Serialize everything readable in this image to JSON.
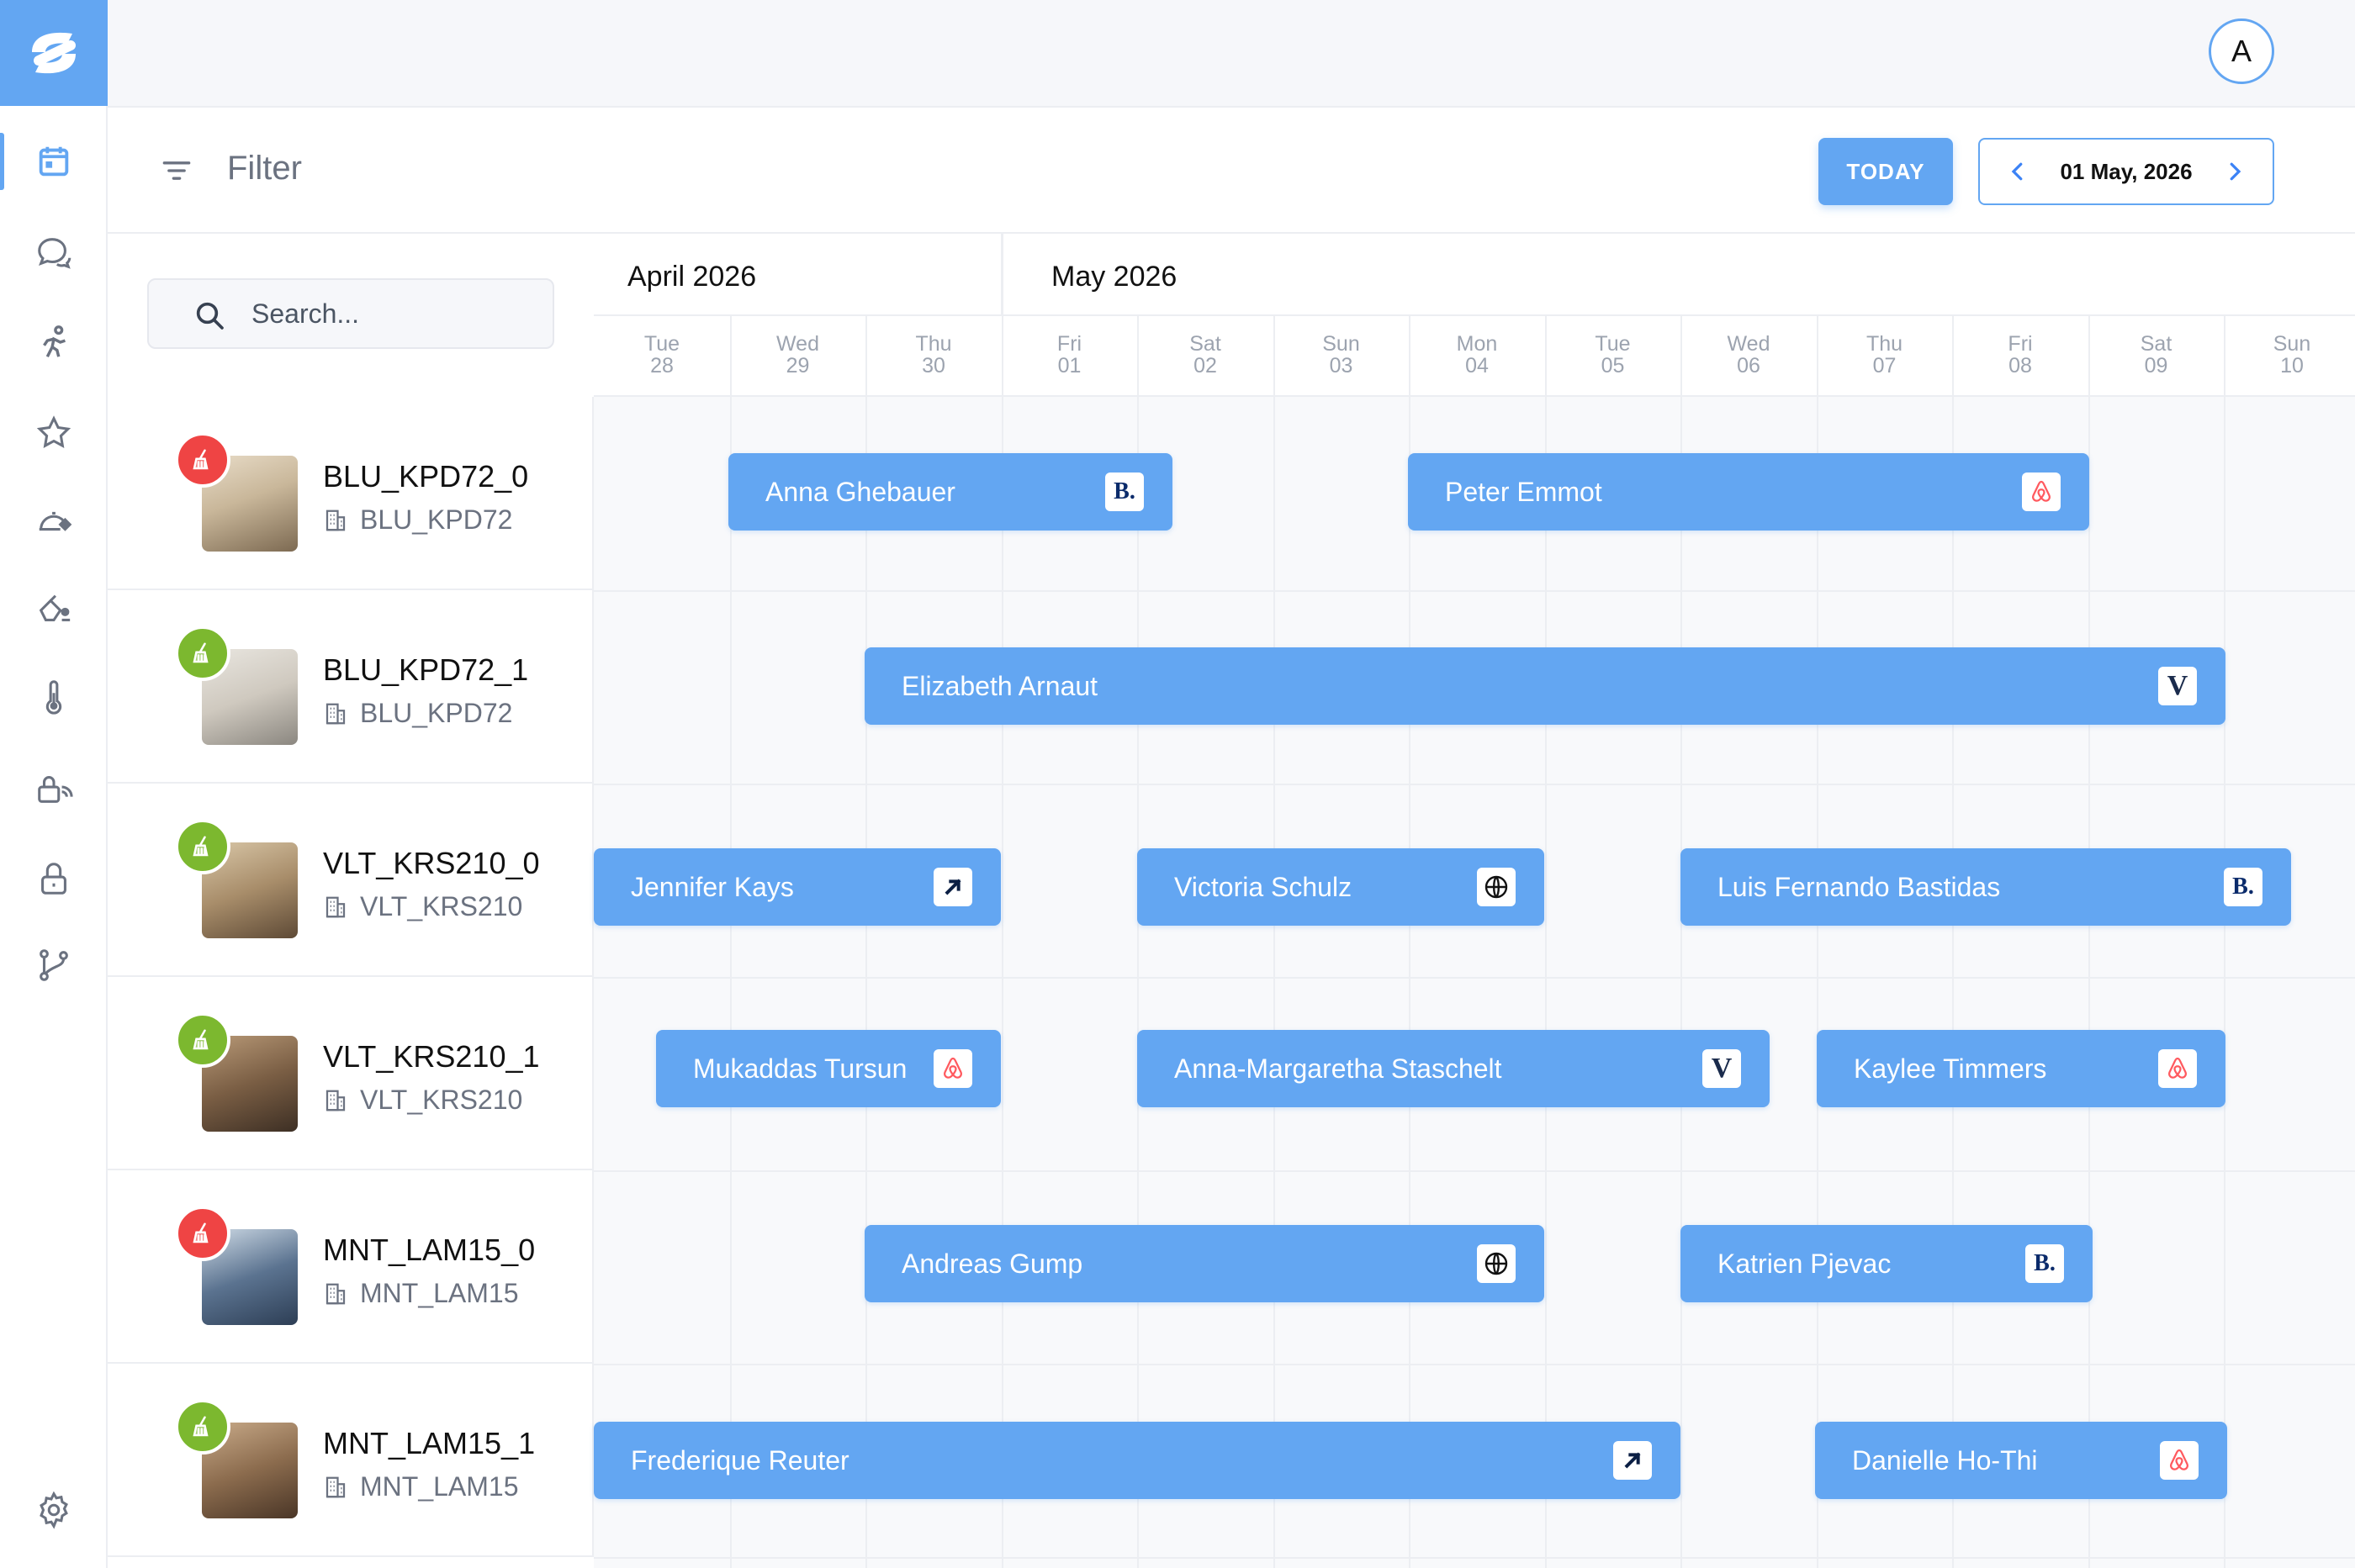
{
  "app": {
    "user_initial": "A",
    "accent_color": "#63a6f2"
  },
  "sidebar": {
    "items": [
      {
        "icon": "calendar-icon",
        "active": true
      },
      {
        "icon": "chat-icon",
        "active": false
      },
      {
        "icon": "activity-icon",
        "active": false
      },
      {
        "icon": "star-icon",
        "active": false
      },
      {
        "icon": "service-tag-icon",
        "active": false
      },
      {
        "icon": "cleaning-icon",
        "active": false
      },
      {
        "icon": "thermometer-icon",
        "active": false
      },
      {
        "icon": "smart-lock-icon",
        "active": false
      },
      {
        "icon": "lock-icon",
        "active": false
      },
      {
        "icon": "branch-icon",
        "active": false
      },
      {
        "icon": "settings-icon",
        "active": false
      }
    ]
  },
  "toolbar": {
    "filter_label": "Filter",
    "today_label": "TODAY",
    "current_date": "01 May, 2026"
  },
  "search": {
    "placeholder": "Search..."
  },
  "calendar": {
    "months": [
      "April 2026",
      "May 2026"
    ],
    "days": [
      {
        "dow": "Tue",
        "day": "28"
      },
      {
        "dow": "Wed",
        "day": "29"
      },
      {
        "dow": "Thu",
        "day": "30"
      },
      {
        "dow": "Fri",
        "day": "01"
      },
      {
        "dow": "Sat",
        "day": "02"
      },
      {
        "dow": "Sun",
        "day": "03"
      },
      {
        "dow": "Mon",
        "day": "04"
      },
      {
        "dow": "Tue",
        "day": "05"
      },
      {
        "dow": "Wed",
        "day": "06"
      },
      {
        "dow": "Thu",
        "day": "07"
      },
      {
        "dow": "Fri",
        "day": "08"
      },
      {
        "dow": "Sat",
        "day": "09"
      },
      {
        "dow": "Sun",
        "day": "10"
      }
    ]
  },
  "rooms": [
    {
      "name": "BLU_KPD72_0",
      "building": "BLU_KPD72",
      "cleaning_status": "dirty",
      "status_color": "#ef4444"
    },
    {
      "name": "BLU_KPD72_1",
      "building": "BLU_KPD72",
      "cleaning_status": "clean",
      "status_color": "#7cb82f"
    },
    {
      "name": "VLT_KRS210_0",
      "building": "VLT_KRS210",
      "cleaning_status": "clean",
      "status_color": "#7cb82f"
    },
    {
      "name": "VLT_KRS210_1",
      "building": "VLT_KRS210",
      "cleaning_status": "clean",
      "status_color": "#7cb82f"
    },
    {
      "name": "MNT_LAM15_0",
      "building": "MNT_LAM15",
      "cleaning_status": "dirty",
      "status_color": "#ef4444"
    },
    {
      "name": "MNT_LAM15_1",
      "building": "MNT_LAM15",
      "cleaning_status": "clean",
      "status_color": "#7cb82f"
    }
  ],
  "bookings": [
    {
      "room": 0,
      "guest": "Anna Ghebauer",
      "channel": "booking.com"
    },
    {
      "room": 0,
      "guest": "Peter Emmot",
      "channel": "airbnb"
    },
    {
      "room": 1,
      "guest": "Elizabeth Arnaut",
      "channel": "vrbo"
    },
    {
      "room": 2,
      "guest": "Jennifer Kays",
      "channel": "expedia"
    },
    {
      "room": 2,
      "guest": "Victoria Schulz",
      "channel": "website"
    },
    {
      "room": 2,
      "guest": "Luis Fernando Bastidas",
      "channel": "booking.com"
    },
    {
      "room": 3,
      "guest": "Mukaddas Tursun",
      "channel": "airbnb"
    },
    {
      "room": 3,
      "guest": "Anna-Margaretha Staschelt",
      "channel": "vrbo"
    },
    {
      "room": 3,
      "guest": "Kaylee Timmers",
      "channel": "airbnb"
    },
    {
      "room": 4,
      "guest": "Andreas Gump",
      "channel": "website"
    },
    {
      "room": 4,
      "guest": "Katrien Pjevac",
      "channel": "booking.com"
    },
    {
      "room": 5,
      "guest": "Frederique Reuter",
      "channel": "expedia"
    },
    {
      "room": 5,
      "guest": "Danielle Ho-Thi",
      "channel": "airbnb"
    }
  ],
  "channels": {
    "booking.com": {
      "text": "B."
    },
    "vrbo": {
      "text": "V"
    }
  }
}
